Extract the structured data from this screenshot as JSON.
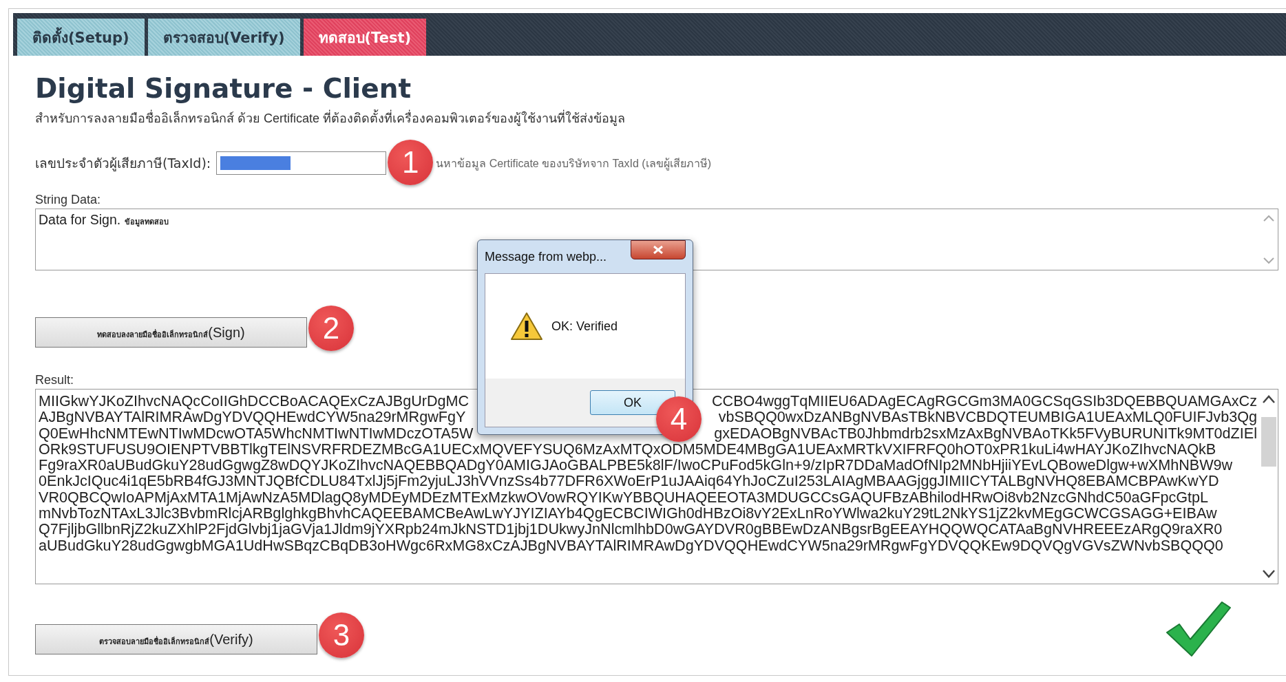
{
  "tabs": [
    {
      "label": "ติดตั้ง(Setup)",
      "selected": false
    },
    {
      "label": "ตรวจสอบ(Verify)",
      "selected": false
    },
    {
      "label": "ทดสอบ(Test)",
      "selected": true
    }
  ],
  "title": "Digital Signature - Client",
  "subtitle": "สำหรับการลงลายมือชื่ออิเล็กทรอนิกส์ ด้วย Certificate ที่ต้องติดตั้งที่เครื่องคอมพิวเตอร์ของผู้ใช้งานที่ใช้ส่งข้อมูล",
  "taxid": {
    "label": "เลขประจำตัวผู้เสียภาษี(TaxId):",
    "hint": "นหาข้อมูล Certificate ของบริษัทจาก TaxId (เลขผู้เสียภาษี)",
    "badge": "1"
  },
  "string_data": {
    "label": "String Data:",
    "value": "Data for Sign. **ข้อมูลทดสอบ**"
  },
  "sign_button": {
    "label": "**ทดสอบลงลายมือชื่ออิเล็กทรอนิกส์**(Sign)",
    "badge": "2"
  },
  "result": {
    "label": "Result:",
    "lines": [
      {
        "kind": "split",
        "left": "MIIGkwYJKoZIhvcNAQcCoIIGhDCCBoACAQExCzAJBgUrDgMC",
        "right": "CCBO4wggTqMIIEU6ADAgECAgRGCGm3MA0GCSqGSIb3DQEBBQUAMGAxCz"
      },
      {
        "kind": "split",
        "left": "AJBgNVBAYTAlRIMRAwDgYDVQQHEwdCYW5na29rMRgwFgY",
        "right": "vbSBQQ0wxDzANBgNVBAsTBkNBVCBDQTEUMBIGA1UEAxMLQ0FUIFJvb3Qg"
      },
      {
        "kind": "split",
        "left": "Q0EwHhcNMTEwNTIwMDcwOTA5WhcNMTIwNTIwMDczOTA5W",
        "right": "gxEDAOBgNVBAcTB0Jhbmdrb2sxMzAxBgNVBAoTKk5FVyBURUNITk9MT0dZIEl"
      },
      {
        "kind": "full",
        "text": "ORk9STUFUSU9OIENPTVBBTlkgTElNSVRFRDEZMBcGA1UECxMQVEFYSUQ6MzAxMTQxODM5MDE4MBgGA1UEAxMRTkVXIFRFQ0hOT0xPR1kuLi4wHAYJKoZIhvcNAQkB"
      },
      {
        "kind": "full",
        "text": "Fg9raXR0aUBudGkuY28udGgwgZ8wDQYJKoZIhvcNAQEBBQADgY0AMIGJAoGBALPBE5k8lF/IwoCPuFod5kGln+9/zIpR7DDaMadOfNIp2MNbHjiiYEvLQBoweDlgw+wXMhNBW9w"
      },
      {
        "kind": "full",
        "text": "0EnkJcIQuc4i1qE5bRB4fGJ3MNTJQBfCDLU84TxlJj5jFm2yjuLJ3hVVnzSs4b77DFR6XWoErP1uJAAiq64YhJoCZuI253LAIAgMBAAGjggJIMIICYTALBgNVHQ8EBAMCBPAwKwYD"
      },
      {
        "kind": "full",
        "text": "VR0QBCQwIoAPMjAxMTA1MjAwNzA5MDlagQ8yMDEyMDEzMTExMzkwOVowRQYIKwYBBQUHAQEEOTA3MDUGCCsGAQUFBzABhilodHRwOi8vb2NzcGNhdC50aGFpcGtpL"
      },
      {
        "kind": "full",
        "text": "mNvbTozNTAxL3Jlc3BvbmRlcjARBglghkgBhvhCAQEEBAMCBeAwLwYJYIZIAYb4QgECBCIWIGh0dHBzOi8vY2ExLnRoYWlwa2kuY29tL2NkYS1jZ2kvMEgGCWCGSAGG+EIBAw"
      },
      {
        "kind": "full",
        "text": "Q7FjljbGllbnRjZ2kuZXhlP2FjdGlvbj1jaGVja1Jldm9jYXRpb24mJkNSTD1jbj1DUkwyJnNlcmlhbD0wGAYDVR0gBBEwDzANBgsrBgEEAYHQQWQCATAaBgNVHREEEzARgQ9raXR0"
      },
      {
        "kind": "full",
        "text": "aUBudGkuY28udGgwgbMGA1UdHwSBqzCBqDB3oHWgc6RxMG8xCzAJBgNVBAYTAlRIMRAwDgYDVQQHEwdCYW5na29rMRgwFgYDVQQKEw9DQVQgVGVsZWNvbSBQQQ0"
      }
    ]
  },
  "verify_button": {
    "label": "**ตรวจสอบลายมือชื่ออิเล็กทรอนิกส์**(Verify)",
    "badge": "3"
  },
  "dialog": {
    "title": "Message from webp...",
    "message": "OK: Verified",
    "button": "OK",
    "badge": "4"
  }
}
